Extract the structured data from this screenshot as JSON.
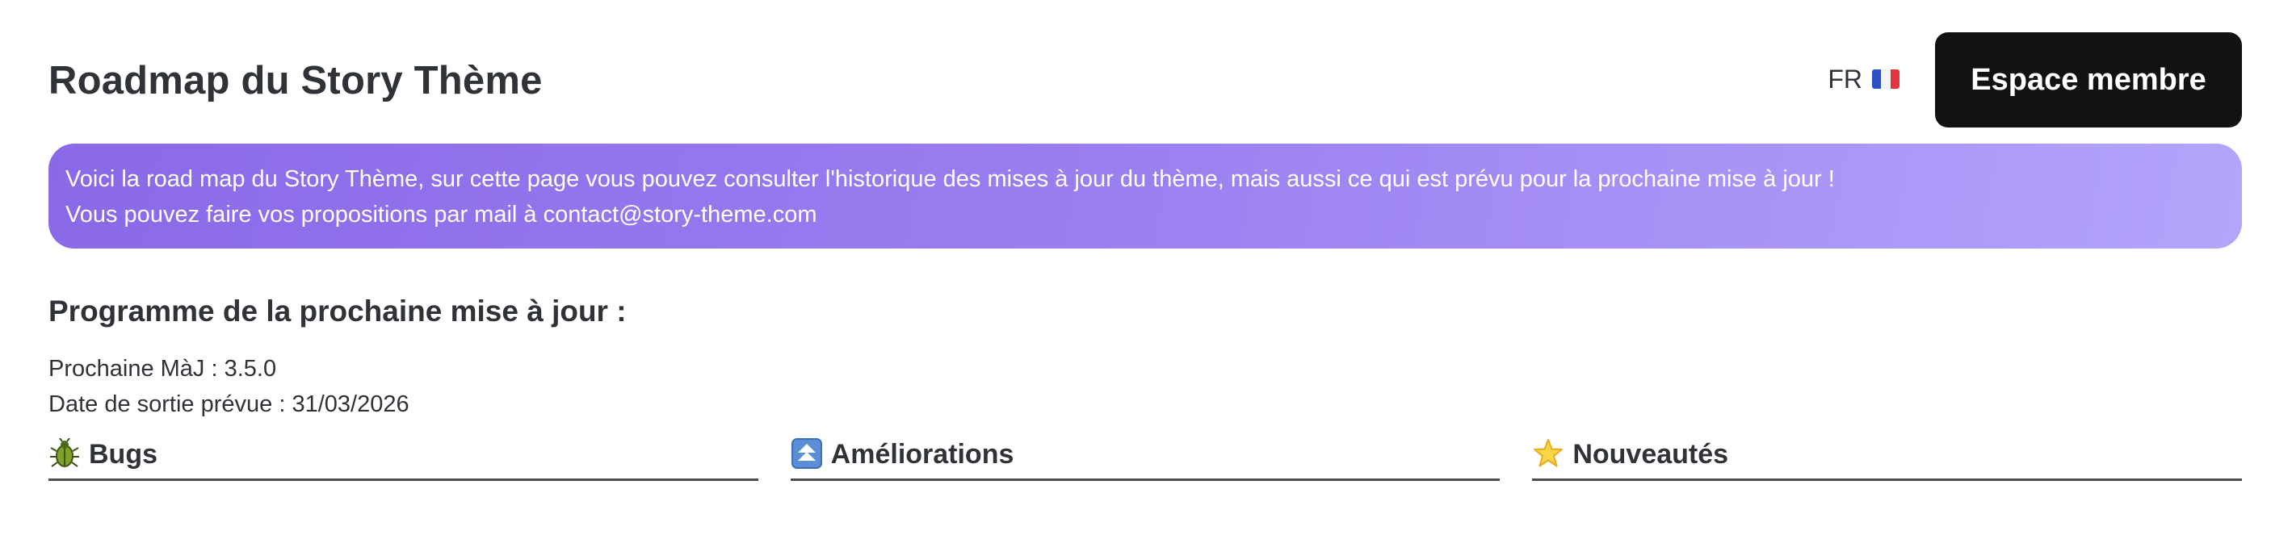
{
  "header": {
    "title": "Roadmap du Story Thème",
    "language": {
      "code": "FR",
      "flag_icon": "france-flag-icon"
    },
    "member_button_label": "Espace membre"
  },
  "banner": {
    "line1": "Voici la road map du Story Thème, sur cette page vous pouvez consulter l'historique des mises à jour du thème, mais aussi ce qui est prévu pour la prochaine mise à jour !",
    "line2": "Vous pouvez faire vos propositions par mail à contact@story-theme.com"
  },
  "next_update": {
    "heading": "Programme de la prochaine mise à jour :",
    "version": "Prochaine MàJ : 3.5.0",
    "release_date": "Date de sortie prévue : 31/03/2026"
  },
  "columns": [
    {
      "label": "Bugs",
      "icon": "beetle-icon"
    },
    {
      "label": "Améliorations",
      "icon": "double-arrow-up-icon"
    },
    {
      "label": "Nouveautés",
      "icon": "star-icon"
    }
  ],
  "colors": {
    "banner_gradient_start": "#8a69e8",
    "banner_gradient_end": "#b4a4fb",
    "button_background": "#121212",
    "text": "#2f3237"
  }
}
